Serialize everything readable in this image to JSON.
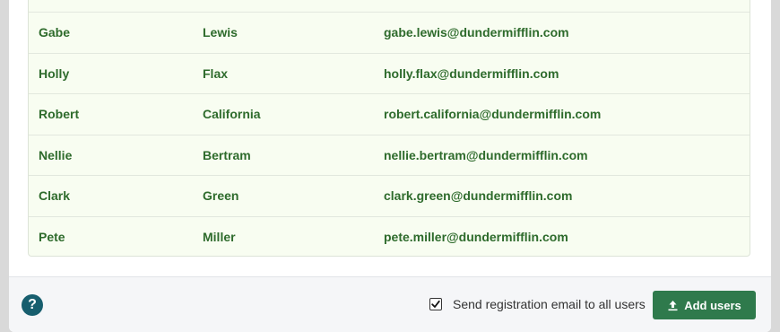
{
  "users": [
    {
      "first": "Gabe",
      "last": "Lewis",
      "email": "gabe.lewis@dundermifflin.com"
    },
    {
      "first": "Holly",
      "last": "Flax",
      "email": "holly.flax@dundermifflin.com"
    },
    {
      "first": "Robert",
      "last": "California",
      "email": "robert.california@dundermifflin.com"
    },
    {
      "first": "Nellie",
      "last": "Bertram",
      "email": "nellie.bertram@dundermifflin.com"
    },
    {
      "first": "Clark",
      "last": "Green",
      "email": "clark.green@dundermifflin.com"
    },
    {
      "first": "Pete",
      "last": "Miller",
      "email": "pete.miller@dundermifflin.com"
    }
  ],
  "footer": {
    "help_label": "?",
    "send_email_checked": true,
    "send_email_label": "Send registration email to all users",
    "add_users_label": "Add users"
  },
  "colors": {
    "row_text": "#2e6b2c",
    "row_background": "#f8fdf1",
    "help_button": "#175e6e",
    "primary_button": "#2f7a4c"
  },
  "icons": {
    "help": "help-icon",
    "checkbox": "checkmark-icon",
    "add_users": "upload-icon"
  }
}
